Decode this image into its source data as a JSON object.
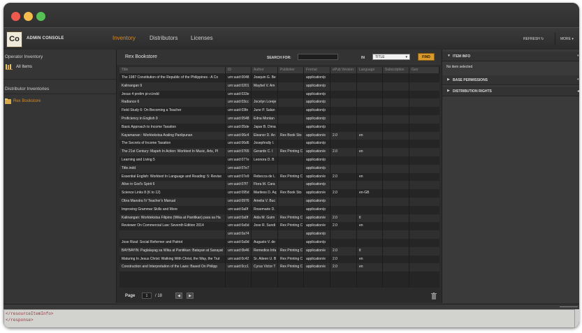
{
  "app": {
    "logo_text": "Co",
    "title": "ADMIN CONSOLE"
  },
  "nav": {
    "inventory": "Inventory",
    "distributors": "Distributors",
    "licenses": "Licenses"
  },
  "toolbar": {
    "refresh": "REFRESH",
    "more": "MORE"
  },
  "sidebar": {
    "operator_inventory": "Operator Inventory",
    "all_items": "All Items",
    "distributor_inventories": "Distributor Inventories",
    "rex_bookstore": "Rex Bookstore"
  },
  "main": {
    "title": "Rex Bookstore",
    "search_label": "SEARCH FOR:",
    "search_value": "",
    "in_label": "IN",
    "in_selected": "TITLE",
    "find_label": "FIND",
    "columns": [
      "Title",
      "ID",
      "Author",
      "Publisher",
      "Format",
      "ePub Version",
      "Language",
      "Subscription",
      "Geo"
    ],
    "rows": [
      [
        "The 1987 Constitution of the Republic of the Philippines - A Co",
        "urn:uuid:0048",
        "Joaquin G. Be",
        "",
        "application/p",
        "",
        "",
        "",
        ""
      ],
      [
        "Kalinangan 9",
        "urn:uuid:0201",
        "Maybel V. Am",
        "",
        "application/p",
        "",
        "",
        "",
        ""
      ],
      [
        "Jesus 4 prelim pi-vi.indd",
        "urn:uuid:033e",
        "",
        "",
        "application/p",
        "",
        "",
        "",
        ""
      ],
      [
        "Radiance 6",
        "urn:uuid:03cc",
        "Jocelyn Loreje",
        "",
        "application/p",
        "",
        "",
        "",
        ""
      ],
      [
        "Field Study 6: On Becoming a Teacher",
        "urn:uuid:03fe",
        "June P. Salan",
        "",
        "application/p",
        "",
        "",
        "",
        ""
      ],
      [
        "Proficiency in English 9",
        "urn:uuid:0548",
        "Edna Montan",
        "",
        "application/p",
        "",
        "",
        "",
        ""
      ],
      [
        "Basic Approach to Income Taxation",
        "urn:uuid:05de",
        "Japar B. Dima",
        "",
        "application/p",
        "",
        "",
        "",
        ""
      ],
      [
        "Kayamanan : Worktekstsa Araling Panlipunan",
        "urn:uuid:06c4",
        "Eleanor D. An",
        "Rex Book Sto",
        "application/e",
        "2.0",
        "en",
        "",
        ""
      ],
      [
        "The Secrets of Income Taxation",
        "urn:uuid:06d6",
        "Josephrally I.",
        "",
        "application/p",
        "",
        "",
        "",
        ""
      ],
      [
        "The 21st Century: Mapeh In Action: Worktext In Music, Arts, Pl",
        "urn:uuid:0765",
        "Gerardo C. I",
        "Rex Printing C",
        "application/e",
        "2.0",
        "en",
        "",
        ""
      ],
      [
        "Learning and Living 5",
        "urn:uuid:077e",
        "Leonora D. B",
        "",
        "application/p",
        "",
        "",
        "",
        ""
      ],
      [
        "Title.indd",
        "urn:uuid:07e7",
        "",
        "",
        "application/p",
        "",
        "",
        "",
        ""
      ],
      [
        "Essential English: Worktext In Language and Reading: 5: Revise",
        "urn:uuid:07e9",
        "Rebecca de L",
        "Rex Printing C",
        "application/e",
        "2.0",
        "en",
        "",
        ""
      ],
      [
        "Alive in God's Spirit 6",
        "urn:uuid:07f7",
        "Flora M. Cara",
        "",
        "application/p",
        "",
        "",
        "",
        ""
      ],
      [
        "Science Links 8 (K to 12)",
        "urn:uuid:095d",
        "Maritess D. Aq",
        "Rex Book Sto",
        "application/e",
        "2.0",
        "en-GB",
        "",
        ""
      ],
      [
        "Obra Maestra IV Teacher's Manual",
        "urn:uuid:0976",
        "Amelia V. Buc",
        "",
        "application/p",
        "",
        "",
        "",
        ""
      ],
      [
        "Improving Grammar Skills and More",
        "urn:uuid:0a0f",
        "Rosemarie D.",
        "",
        "application/p",
        "",
        "",
        "",
        ""
      ],
      [
        "Kalinangan: Worktekstsa Filipino (Wika at Panitikan) para sa Ha",
        "urn:uuid:0a0f",
        "Aida M. Guim",
        "Rex Printing C",
        "application/e",
        "2.0",
        "tl",
        "",
        ""
      ],
      [
        "Reviewer On Commercial Law: Seventh Edition 2014",
        "urn:uuid:0a5d",
        "Jose R. Sundi",
        "Rex Printing C",
        "application/e",
        "2.0",
        "en",
        "",
        ""
      ],
      [
        "",
        "urn:uuid:0a74",
        "",
        "",
        "application/p",
        "",
        "",
        "",
        ""
      ],
      [
        "Jose Rizal: Social Reformer and Patriot",
        "urn:uuid:0a9d",
        "Augusto V. de",
        "",
        "application/p",
        "",
        "",
        "",
        ""
      ],
      [
        "BAYBAYIN: Paglalayag sa Wika at Panitikan: Batayan at Sanayat",
        "urn:uuid:0b46",
        "Remedios Infa",
        "Rex Printing C",
        "application/e",
        "2.0",
        "tl",
        "",
        ""
      ],
      [
        "Maturing In Jesus Christ: Walking With Christ, the Way, the Trut",
        "urn:uuid:0c42",
        "Sr. Aileen U. B",
        "Rex Printing C",
        "application/e",
        "2.0",
        "en",
        "",
        ""
      ],
      [
        "Construction and Interpretation of the Laws: Based On Philipp",
        "urn:uuid:0cc1",
        "Cyrus Victor T",
        "Rex Printing C",
        "application/e",
        "2.0",
        "en",
        "",
        ""
      ]
    ],
    "pager": {
      "label": "Page",
      "current": "1",
      "total": "/ 18"
    }
  },
  "details": {
    "item_info": "ITEM INFO",
    "no_item": "No item selected",
    "base_permissions": "BASE PERMISSIONS",
    "distribution_rights": "DISTRIBUTION RIGHTS"
  },
  "console": {
    "line1": "</resourceItemInfo>",
    "line2": "</response>"
  },
  "colors": {
    "accent": "#d48a2c",
    "find_button": "#d99a2d",
    "close": "#ef5a4f",
    "minimize": "#f5bd4f",
    "maximize": "#58c155"
  }
}
